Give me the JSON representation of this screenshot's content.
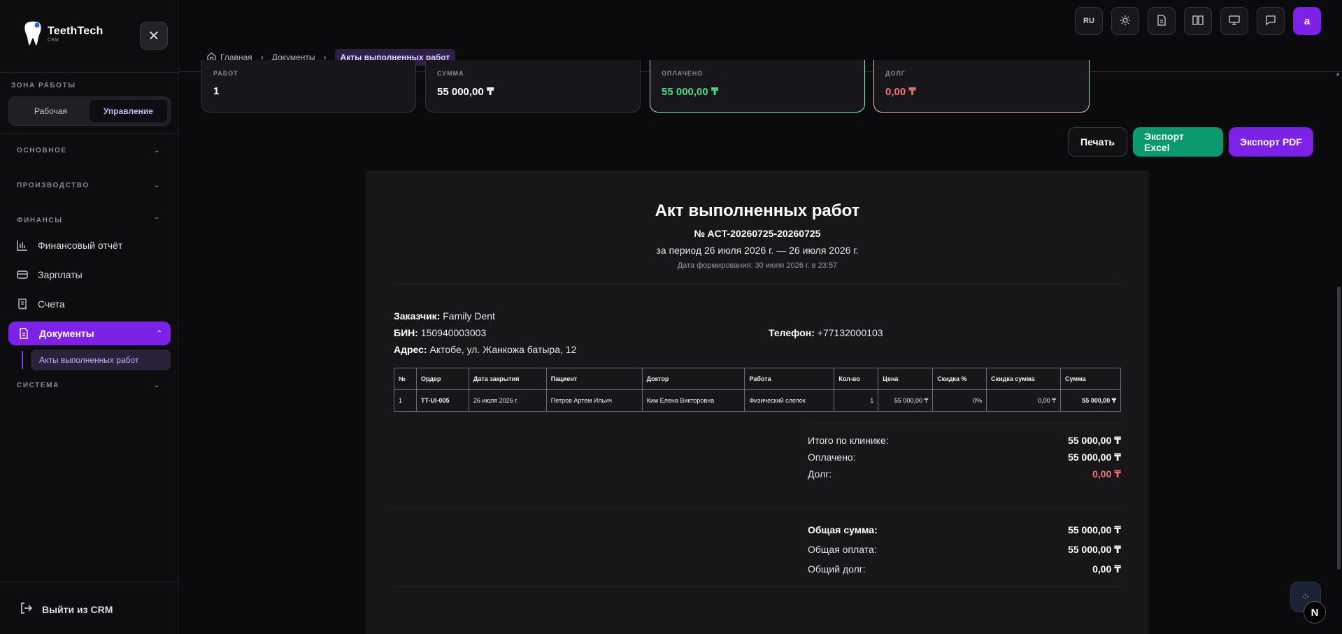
{
  "app": {
    "name": "TeethTech",
    "subtitle": "CRM"
  },
  "sidebar": {
    "zone_label": "ЗОНА РАБОТЫ",
    "zone_options": [
      "Рабочая",
      "Управление"
    ],
    "zone_active": "Управление",
    "sections": {
      "main": "ОСНОВНОЕ",
      "production": "ПРОИЗВОДСТВО",
      "finance": "ФИНАНСЫ",
      "system": "СИСТЕМА"
    },
    "items": {
      "finance_report": "Финансовый отчёт",
      "salaries": "Зарплаты",
      "invoices": "Счета",
      "documents": "Документы",
      "acts": "Акты выполненных работ"
    },
    "logout": "Выйти из CRM"
  },
  "header": {
    "breadcrumb": [
      "Главная",
      "Документы",
      "Акты выполненных работ"
    ],
    "lang": "RU",
    "avatar": "a"
  },
  "stats": [
    {
      "label": "РАБОТ",
      "value": "1"
    },
    {
      "label": "СУММА",
      "value": "55 000,00 ₸"
    },
    {
      "label": "ОПЛАЧЕНО",
      "value": "55 000,00 ₸"
    },
    {
      "label": "ДОЛГ",
      "value": "0,00 ₸"
    }
  ],
  "actions": {
    "print": "Печать",
    "excel": "Экспорт Excel",
    "pdf": "Экспорт PDF"
  },
  "document": {
    "title": "Акт выполненных работ",
    "number": "№ ACT-20260725-20260725",
    "period": "за период 26 июля 2026 г. — 26 июля 2026 г.",
    "generated": "Дата формирования: 30 июля 2026 г. в 23:57",
    "customer_label": "Заказчик:",
    "customer": "Family Dent",
    "bin_label": "БИН:",
    "bin": "150940003003",
    "phone_label": "Телефон:",
    "phone": "+77132000103",
    "address_label": "Адрес:",
    "address": "Актобе, ул. Жанкожа батыра, 12",
    "table": {
      "headers": [
        "№",
        "Ордер",
        "Дата закрытия",
        "Пациент",
        "Доктор",
        "Работа",
        "Кол-во",
        "Цена",
        "Скидка %",
        "Скидка сумма",
        "Сумма"
      ],
      "rows": [
        [
          "1",
          "TT-UI-005",
          "26 июля 2026 г.",
          "Петров Артем Ильич",
          "Ким Елена Викторовна",
          "Физический слепок",
          "1",
          "55 000,00 ₸",
          "0%",
          "0,00 ₸",
          "55 000,00 ₸"
        ]
      ]
    },
    "clinic_totals": {
      "total_label": "Итого по клинике:",
      "total": "55 000,00 ₸",
      "paid_label": "Оплачено:",
      "paid": "55 000,00 ₸",
      "debt_label": "Долг:",
      "debt": "0,00 ₸"
    },
    "grand_totals": {
      "sum_label": "Общая сумма:",
      "sum": "55 000,00 ₸",
      "paid_label": "Общая оплата:",
      "paid": "55 000,00 ₸",
      "debt_label": "Общий долг:",
      "debt": "0,00 ₸"
    }
  },
  "floating": {
    "badge": "N"
  }
}
